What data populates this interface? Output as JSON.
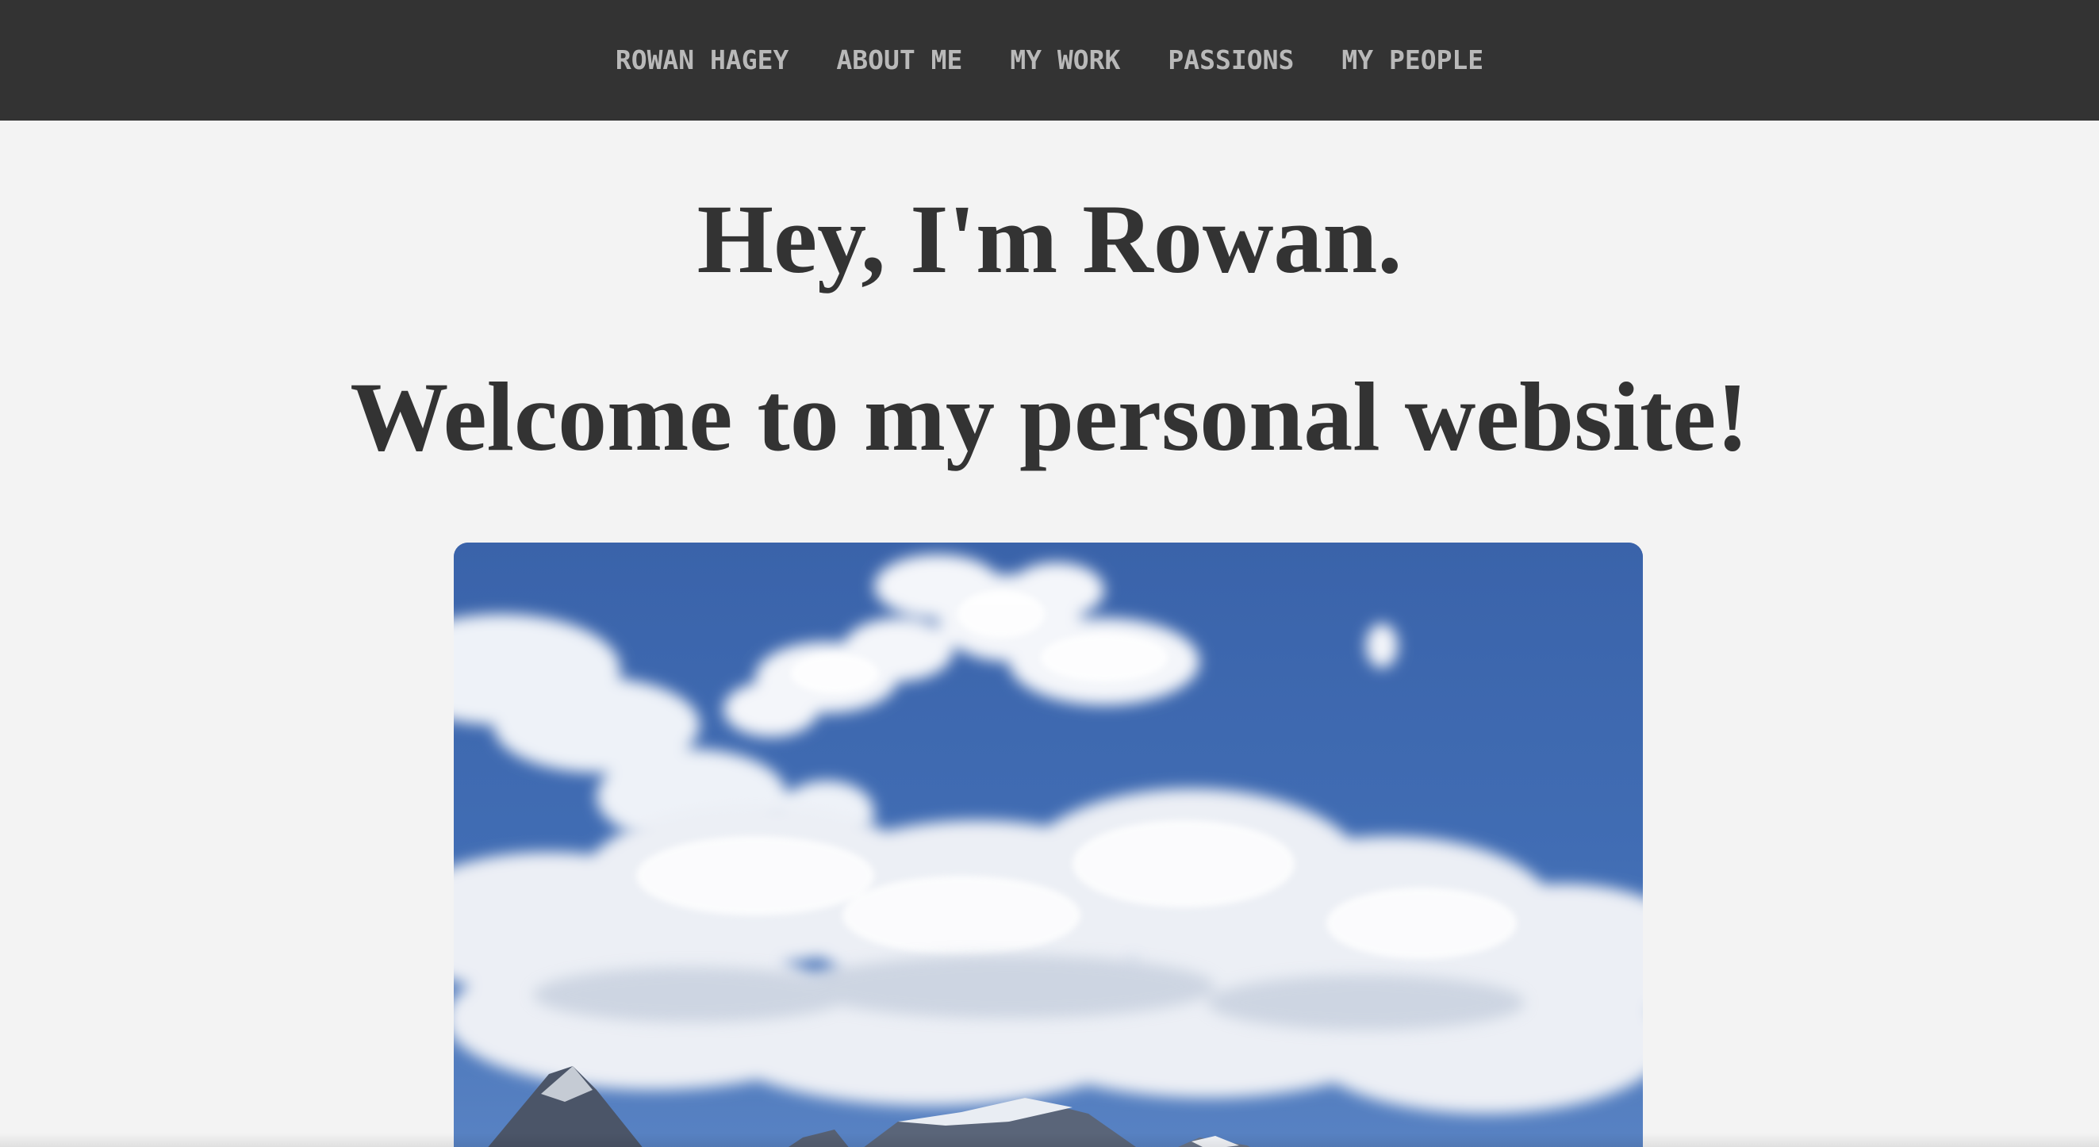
{
  "nav": {
    "items": [
      {
        "label": "ROWAN HAGEY"
      },
      {
        "label": "ABOUT ME"
      },
      {
        "label": "MY WORK"
      },
      {
        "label": "PASSIONS"
      },
      {
        "label": "MY PEOPLE"
      }
    ]
  },
  "main": {
    "greeting": "Hey, I'm Rowan.",
    "welcome": "Welcome to my personal website!"
  },
  "hero_image": {
    "subject": "sky-clouds-mountains-photo"
  },
  "colors": {
    "navbar_bg": "#333333",
    "nav_text": "#b9b9b9",
    "page_bg": "#f3f3f3",
    "heading_text": "#333333",
    "sky_blue": "#3e68ad"
  }
}
